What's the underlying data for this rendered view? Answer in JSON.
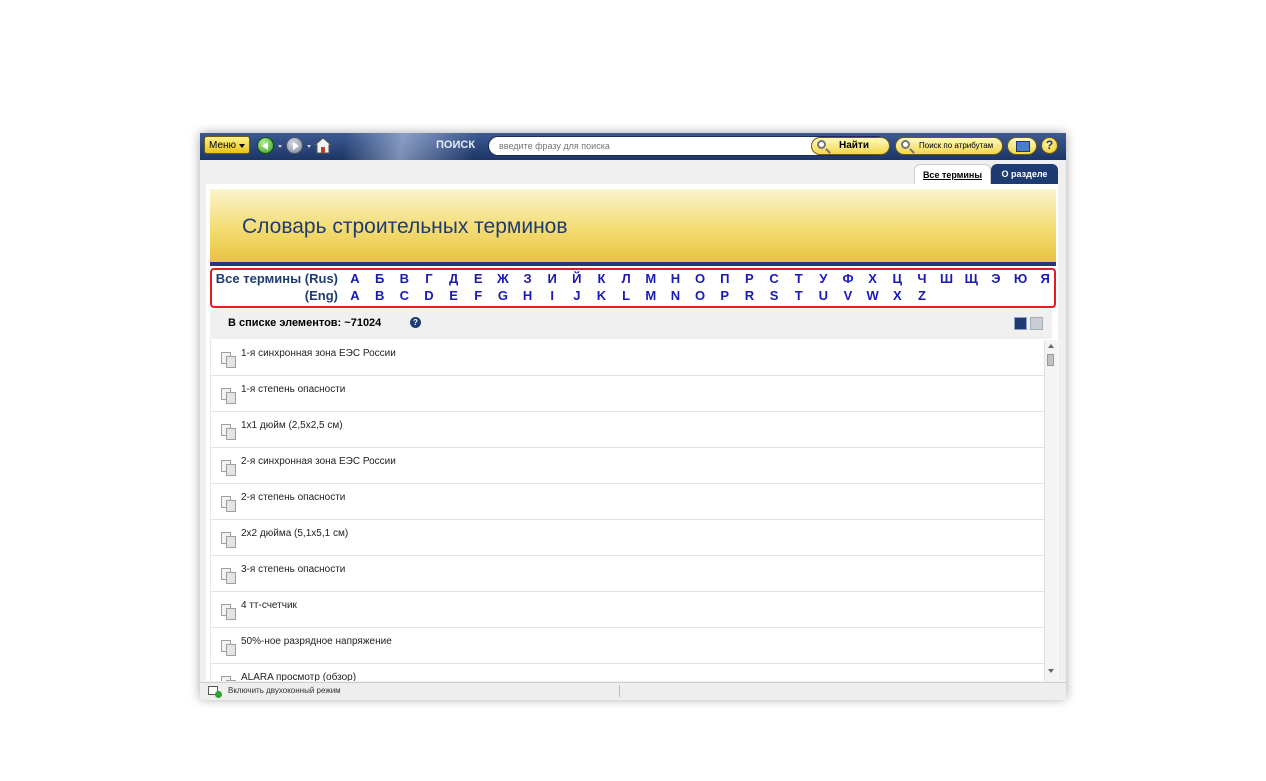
{
  "toolbar": {
    "menu_label": "Меню",
    "search_label": "ПОИСК",
    "search_placeholder": "введите фразу для поиска",
    "find_label": "Найти",
    "attr_search_label": "Поиск по атрибутам",
    "help_label": "?"
  },
  "tabs": [
    {
      "label": "Все термины",
      "active": true
    },
    {
      "label": "О разделе",
      "active": false
    }
  ],
  "page": {
    "title": "Словарь строительных терминов"
  },
  "alphabet": {
    "rus_label": "Все термины (Rus)",
    "eng_label": "(Eng)",
    "rus_letters": [
      "А",
      "Б",
      "В",
      "Г",
      "Д",
      "Е",
      "Ж",
      "З",
      "И",
      "Й",
      "К",
      "Л",
      "М",
      "Н",
      "О",
      "П",
      "Р",
      "С",
      "Т",
      "У",
      "Ф",
      "Х",
      "Ц",
      "Ч",
      "Ш",
      "Щ",
      "Э",
      "Ю",
      "Я"
    ],
    "eng_letters": [
      "A",
      "B",
      "C",
      "D",
      "E",
      "F",
      "G",
      "H",
      "I",
      "J",
      "K",
      "L",
      "M",
      "N",
      "O",
      "P",
      "R",
      "S",
      "T",
      "U",
      "V",
      "W",
      "X",
      "Z"
    ]
  },
  "list": {
    "count_label": "В списке элементов: ~71024",
    "info_icon": "info-icon",
    "items": [
      "1-я синхронная зона ЕЭС России",
      "1-я степень опасности",
      "1х1 дюйм (2,5х2,5 см)",
      "2-я синхронная зона ЕЭС России",
      "2-я степень опасности",
      "2х2 дюйма (5,1х5,1 см)",
      "3-я степень опасности",
      "4 тт-счетчик",
      "50%-ное разрядное напряжение",
      "ALARA просмотр (обзор)"
    ]
  },
  "status": {
    "dual_window_label": "Включить двухоконный режим"
  },
  "colors": {
    "toolbar_bg": "#1d3566",
    "accent_yellow": "#f3d74a",
    "title_blue": "#1f3b73",
    "letter_blue": "#1a1ab8",
    "highlight_red": "#e51c1c"
  }
}
